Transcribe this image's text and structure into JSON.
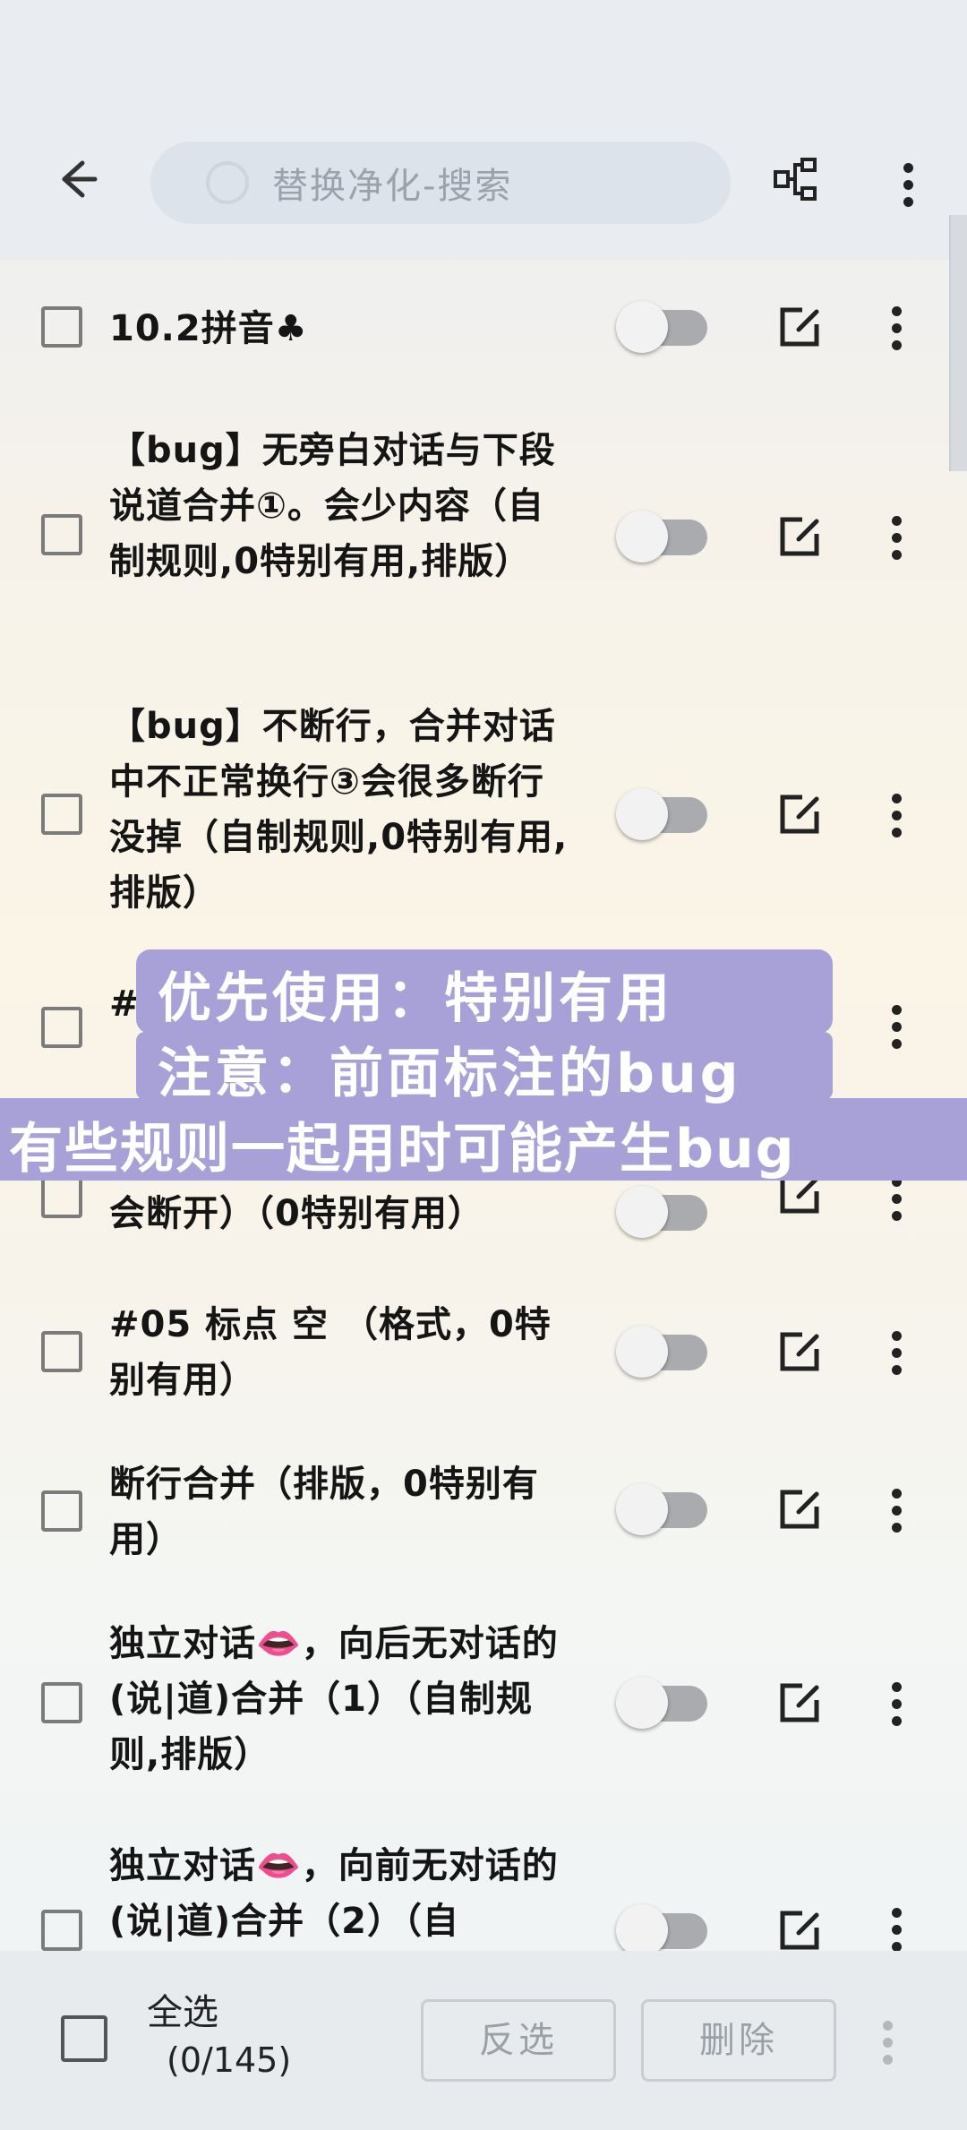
{
  "toolbar": {
    "search_placeholder": "替换净化-搜索"
  },
  "rules": [
    {
      "title": "10.2拼音♣",
      "enabled": false
    },
    {
      "title": "【bug】无旁白对话与下段说道合并①。会少内容（自制规则,0特别有用,排版）",
      "enabled": false
    },
    {
      "title": "【bug】不断行，合并对话中不正常换行③会很多断行没掉（自制规则,0特别有用,排版）",
      "enabled": false
    },
    {
      "title": "#",
      "enabled": false
    },
    {
      "title": "会断开）（0特别有用）",
      "enabled": false
    },
    {
      "title": "#05 标点 空 （格式，0特别有用）",
      "enabled": false
    },
    {
      "title": "断行合并（排版，0特别有用）",
      "enabled": false
    },
    {
      "title": "独立对话👄，向后无对话的(说|道)合并（1）（自制规则,排版）",
      "enabled": false
    },
    {
      "title": "独立对话👄，向前无对话的(说|道)合并（2）（自",
      "enabled": false
    }
  ],
  "overlay": {
    "line1": "优先使用：特别有用",
    "line2": "注意：前面标注的bug",
    "line3": "有些规则一起用时可能产生bug"
  },
  "bottom": {
    "select_all_label": "全选",
    "count": "(0/145)",
    "invert_label": "反选",
    "delete_label": "删除"
  }
}
